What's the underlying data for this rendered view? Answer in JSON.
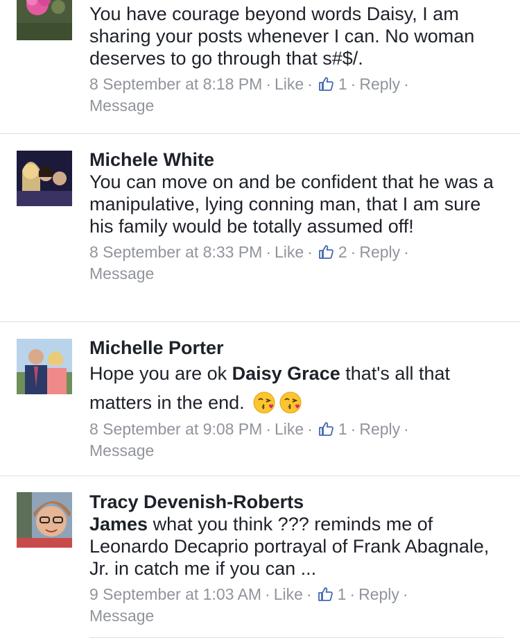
{
  "comments": [
    {
      "author": "",
      "text": "You have courage beyond words Daisy, I am sharing your posts whenever I can. No woman deserves to go through that s#$/.",
      "timestamp": "8 September at 8:18 PM",
      "like_label": "Like",
      "like_count": "1",
      "reply_label": "Reply",
      "message_label": "Message"
    },
    {
      "author": "Michele White",
      "text": "You can move on and be confident that he was a manipulative, lying conning man, that I am sure  his family would be totally assumed off!",
      "timestamp": "8 September at 8:33 PM",
      "like_label": "Like",
      "like_count": "2",
      "reply_label": "Reply",
      "message_label": "Message"
    },
    {
      "author": "Michelle Porter",
      "text_before": "Hope you are ok ",
      "mention": "Daisy Grace",
      "text_after": " that's all that matters in the end.",
      "emojis": [
        "kissing-heart-emoji",
        "kissing-heart-emoji"
      ],
      "timestamp": "8 September at 9:08 PM",
      "like_label": "Like",
      "like_count": "1",
      "reply_label": "Reply",
      "message_label": "Message"
    },
    {
      "author": "Tracy Devenish-Roberts",
      "mention": "James",
      "text_after": " what you think ??? reminds me of Leonardo Decaprio portrayal of Frank Abagnale, Jr. in catch me if you can ...",
      "timestamp": "9 September at 1:03 AM",
      "like_label": "Like",
      "like_count": "1",
      "reply_label": "Reply",
      "message_label": "Message"
    }
  ],
  "colors": {
    "meta": "#90949c",
    "text": "#1d2129",
    "divider": "#dddfe2"
  }
}
